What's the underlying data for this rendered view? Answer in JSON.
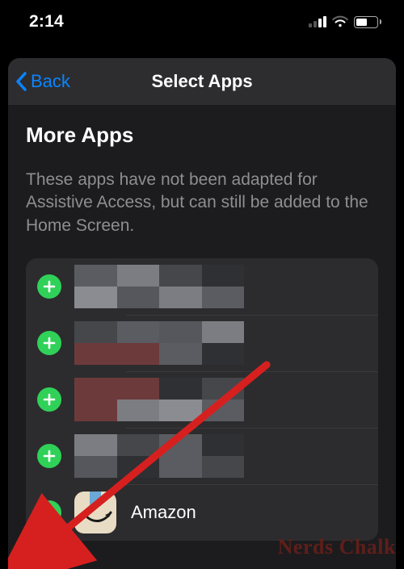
{
  "status": {
    "time": "2:14"
  },
  "nav": {
    "back_label": "Back",
    "title": "Select Apps"
  },
  "section": {
    "title": "More Apps",
    "description": "These apps have not been adapted for Assistive Access, but can still be added to the Home Screen."
  },
  "apps": {
    "row5_label": "Amazon"
  },
  "watermark": "Nerds Chalk",
  "colors": {
    "accent_blue": "#0a84ff",
    "add_green": "#30d158",
    "arrow_red": "#d6201f"
  }
}
